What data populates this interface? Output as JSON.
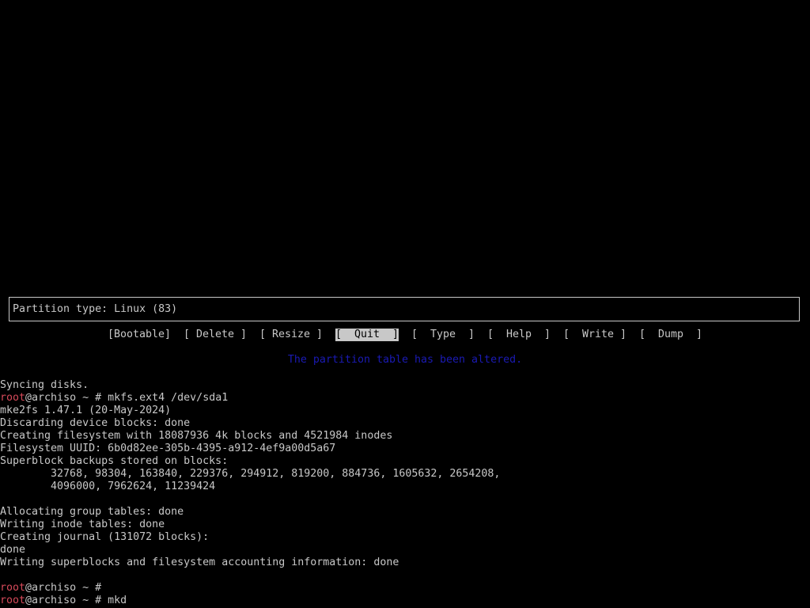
{
  "colors": {
    "background": "#000000",
    "text": "#c8c8c8",
    "prompt_user": "#d64a5a",
    "status_message": "#1a1ab4"
  },
  "partition_type": "Partition type: Linux (83)",
  "menu": {
    "selected": "Quit",
    "items": [
      {
        "label": "[Bootable]"
      },
      {
        "label": "[ Delete ]"
      },
      {
        "label": "[ Resize ]"
      },
      {
        "label": "[  Quit  ]"
      },
      {
        "label": "[  Type  ]"
      },
      {
        "label": "[  Help  ]"
      },
      {
        "label": "[  Write ]"
      },
      {
        "label": "[  Dump  ]"
      }
    ]
  },
  "status_message": "The partition table has been altered.",
  "terminal": {
    "lines": [
      "Syncing disks.",
      {
        "user": "root",
        "host": "@archiso ~ # ",
        "cmd": "mkfs.ext4 /dev/sda1"
      },
      "mke2fs 1.47.1 (20-May-2024)",
      "Discarding device blocks: done",
      "Creating filesystem with 18087936 4k blocks and 4521984 inodes",
      "Filesystem UUID: 6b0d82ee-305b-4395-a912-4ef9a00d5a67",
      "Superblock backups stored on blocks:",
      "        32768, 98304, 163840, 229376, 294912, 819200, 884736, 1605632, 2654208,",
      "        4096000, 7962624, 11239424",
      "",
      "Allocating group tables: done",
      "Writing inode tables: done",
      "Creating journal (131072 blocks):",
      "done",
      "Writing superblocks and filesystem accounting information: done",
      "",
      {
        "user": "root",
        "host": "@archiso ~ # ",
        "cmd": ""
      },
      {
        "user": "root",
        "host": "@archiso ~ # ",
        "cmd": "mkd"
      }
    ]
  }
}
